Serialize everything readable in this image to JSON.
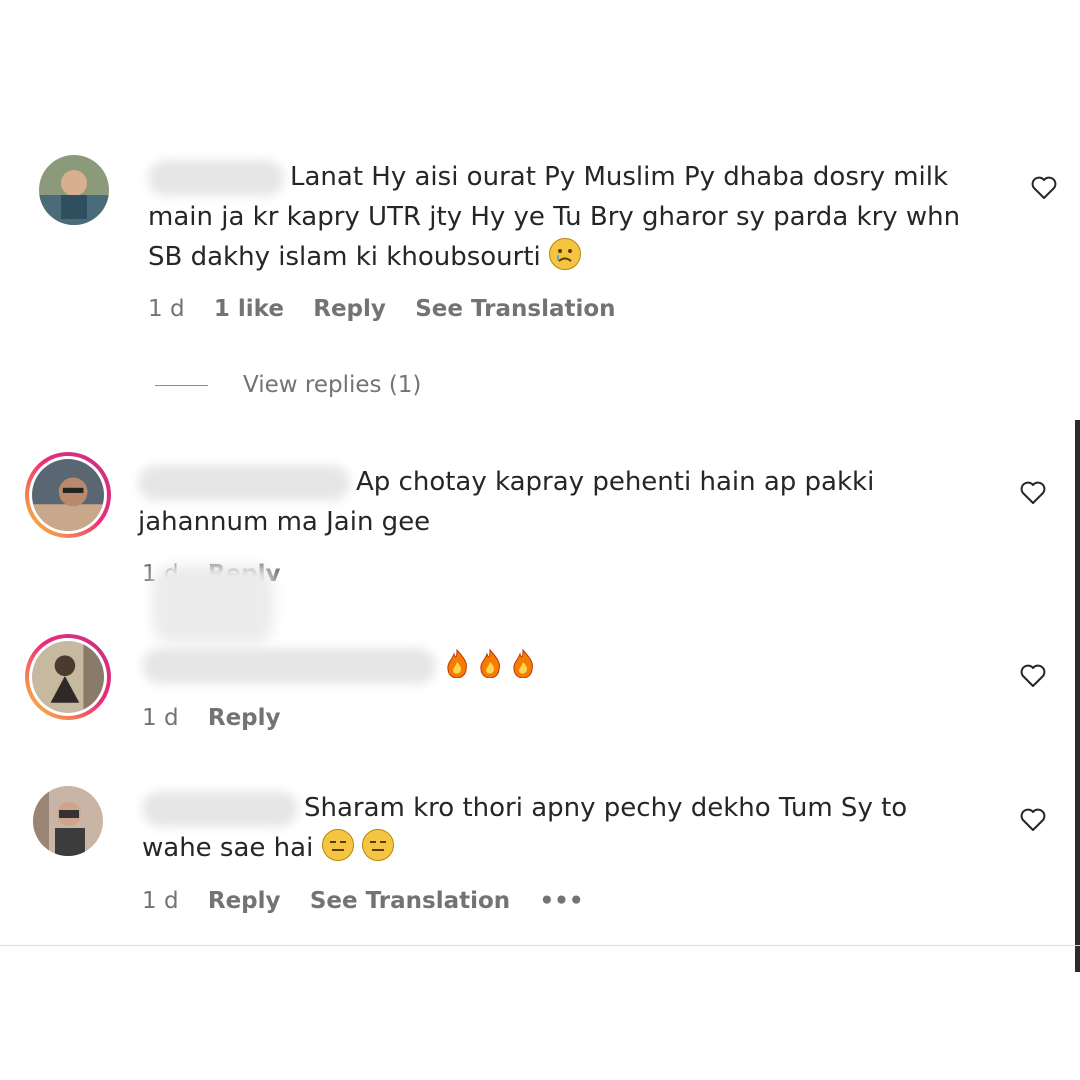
{
  "comments": [
    {
      "text_line1": "Lanat Hy aisi ourat Py Muslim Py dhaba dosry milk",
      "text_line2": "main ja kr kapry UTR jty Hy ye Tu Bry gharor sy parda kry whn",
      "text_line3": "SB dakhy islam ki khoubsourti",
      "time": "1 d",
      "likes": "1 like",
      "reply": "Reply",
      "translate": "See Translation"
    },
    {
      "text_line1": "Ap chotay kapray pehenti hain ap pakki",
      "text_line2": "jahannum ma Jain gee",
      "time": "1 d",
      "reply": "Reply"
    },
    {
      "time": "1 d",
      "reply": "Reply"
    },
    {
      "text_line1": "Sharam kro thori apny pechy dekho Tum Sy to",
      "text_line2": "wahe sae hai",
      "time": "1 d",
      "reply": "Reply",
      "translate": "See Translation",
      "more": "•••"
    }
  ],
  "view_replies": "View replies (1)",
  "icons": {
    "like": "heart-outline-icon",
    "sad_emoji": "crying-face-icon",
    "fire_emoji": "fire-icon",
    "neutral_emoji": "expressionless-face-icon",
    "more": "more-options-icon"
  }
}
